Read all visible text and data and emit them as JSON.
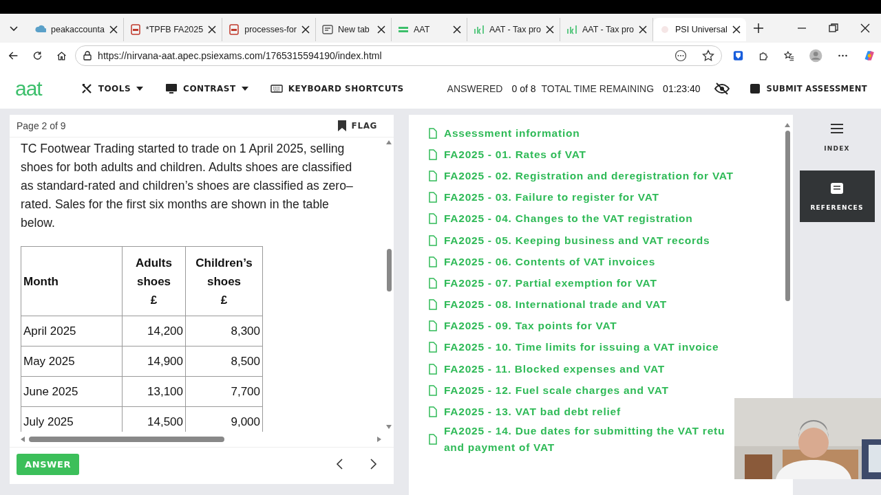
{
  "browser": {
    "tabs": [
      {
        "label": "peakaccounta",
        "kind": "cloud",
        "selected": false
      },
      {
        "label": "*TPFB FA2025",
        "kind": "pdf",
        "selected": false
      },
      {
        "label": "processes-for",
        "kind": "pdf",
        "selected": false
      },
      {
        "label": "New tab",
        "kind": "page",
        "selected": false
      },
      {
        "label": "AAT",
        "kind": "bars",
        "selected": false
      },
      {
        "label": "AAT - Tax pro",
        "kind": "aat",
        "selected": false
      },
      {
        "label": "AAT - Tax pro",
        "kind": "aat",
        "selected": false
      },
      {
        "label": "PSI Universal",
        "kind": "psi",
        "selected": true
      }
    ],
    "url": "https://nirvana-aat.apec.psiexams.com/1765315594190/index.html"
  },
  "header": {
    "logo": "aat",
    "menus": [
      {
        "label": "TOOLS",
        "kind": "tools"
      },
      {
        "label": "CONTRAST",
        "kind": "monitor"
      },
      {
        "label": "KEYBOARD SHORTCUTS",
        "kind": "keyboard"
      }
    ],
    "answered_label": "ANSWERED",
    "answered": "0 of 8",
    "time_label": "TOTAL TIME REMAINING",
    "time": "01:23:40",
    "submit": "SUBMIT ASSESSMENT"
  },
  "question": {
    "page": "Page 2 of 9",
    "flag": "FLAG",
    "text": "TC Footwear Trading started to trade on 1 April 2025, selling shoes for both adults and children. Adults shoes are classified as standard-rated and children’s shoes are classified as zero–rated. Sales for the first six months are shown in the table below.",
    "table": {
      "columns": [
        "Month",
        "Adults\nshoes\n£",
        "Children’s\nshoes\n£"
      ],
      "rows": [
        [
          "April 2025",
          "14,200",
          "8,300"
        ],
        [
          "May 2025",
          "14,900",
          "8,500"
        ],
        [
          "June 2025",
          "13,100",
          "7,700"
        ],
        [
          "July 2025",
          "14,500",
          "9,000"
        ]
      ]
    },
    "answer": "ANSWER"
  },
  "index": {
    "items": [
      {
        "lines": [
          "Assessment information"
        ]
      },
      {
        "lines": [
          "FA2025 - 01. Rates of VAT"
        ]
      },
      {
        "lines": [
          "FA2025 - 02. Registration and deregistration for VAT"
        ]
      },
      {
        "lines": [
          "FA2025 - 03. Failure to register for VAT"
        ]
      },
      {
        "lines": [
          "FA2025 - 04. Changes to the VAT registration"
        ]
      },
      {
        "lines": [
          "FA2025 - 05. Keeping business and VAT records"
        ]
      },
      {
        "lines": [
          "FA2025 - 06. Contents of VAT invoices"
        ]
      },
      {
        "lines": [
          "FA2025 - 07. Partial exemption for VAT"
        ]
      },
      {
        "lines": [
          "FA2025 - 08. International trade and VAT"
        ]
      },
      {
        "lines": [
          "FA2025 - 09. Tax points for VAT"
        ]
      },
      {
        "lines": [
          "FA2025 - 10. Time limits for issuing a VAT invoice"
        ]
      },
      {
        "lines": [
          "FA2025 - 11. Blocked expenses and VAT"
        ]
      },
      {
        "lines": [
          "FA2025 - 12. Fuel scale charges and VAT"
        ]
      },
      {
        "lines": [
          "FA2025 - 13. VAT bad debt relief"
        ]
      },
      {
        "lines": [
          "FA2025 - 14. Due dates for submitting the VAT retu",
          "and payment of VAT"
        ]
      }
    ]
  },
  "rail": [
    {
      "label": "INDEX",
      "kind": "menu",
      "selected": false
    },
    {
      "label": "REFERENCES",
      "kind": "document",
      "selected": true
    }
  ]
}
